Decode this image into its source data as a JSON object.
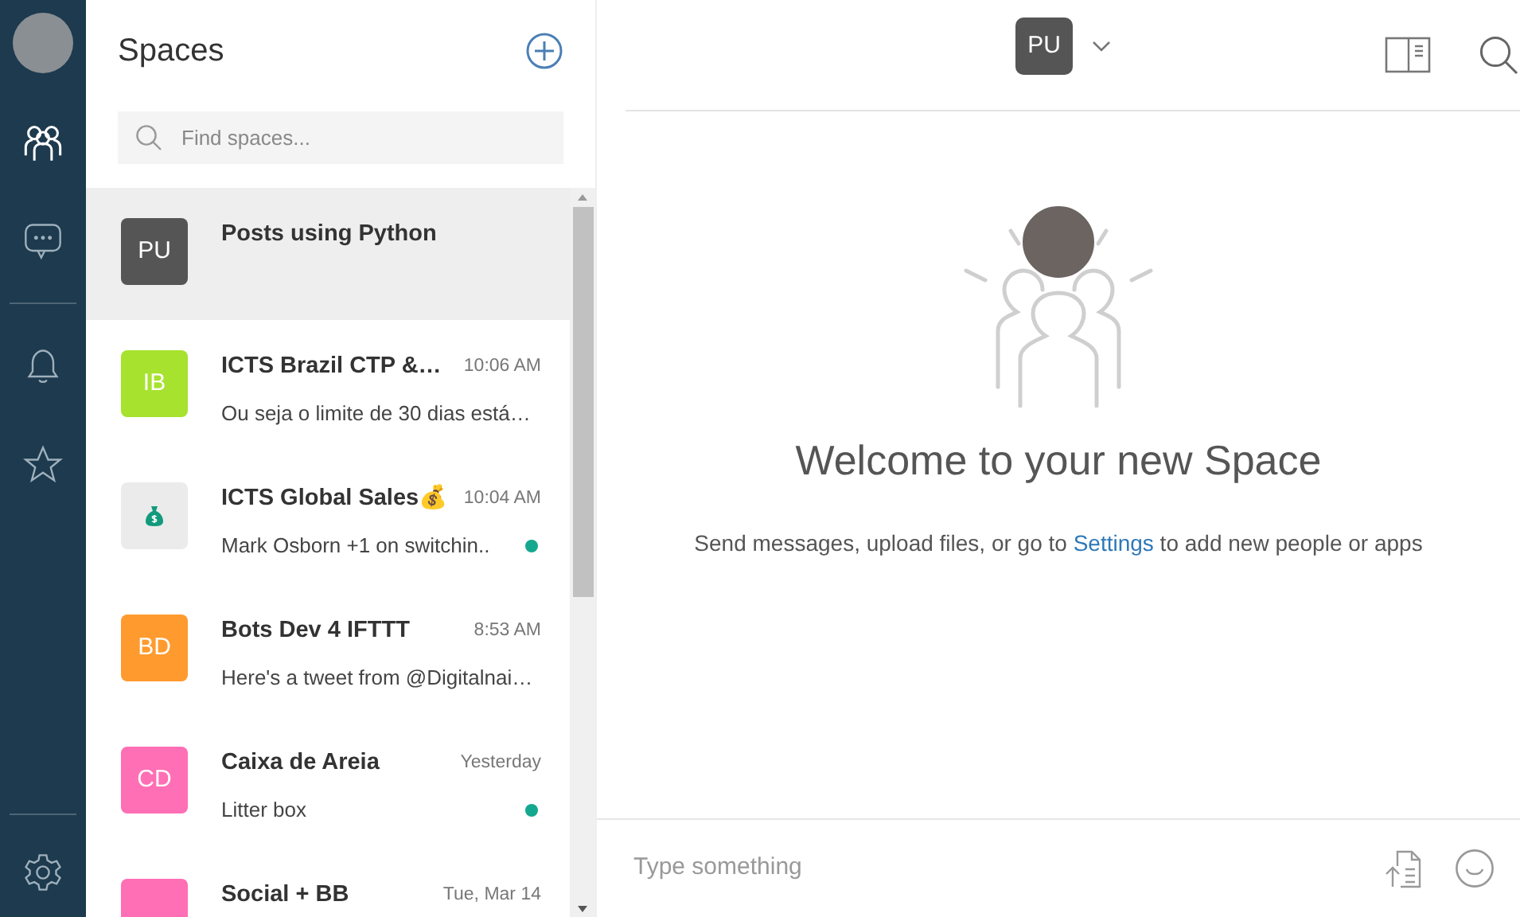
{
  "rail": {
    "items": [
      {
        "kind": "spaces",
        "selected": true
      },
      {
        "kind": "chat",
        "selected": false
      },
      {
        "kind": "bell",
        "selected": false
      },
      {
        "kind": "star",
        "selected": false
      }
    ]
  },
  "spaces": {
    "title": "Spaces",
    "search": {
      "placeholder": "Find spaces..."
    },
    "items": [
      {
        "initials": "PU",
        "color": "#555555",
        "name": "Posts using Python",
        "selected": true,
        "unread": false
      },
      {
        "initials": "IB",
        "color": "#a6e22e",
        "name": "ICTS Brazil CTP &…",
        "time": "10:06 AM",
        "preview": "Ou seja o limite de 30 dias está…",
        "selected": false,
        "unread": false
      },
      {
        "kind": "icon",
        "color": "#ebebeb",
        "name": "ICTS Global Sales💰",
        "time": "10:04 AM",
        "preview": "Mark Osborn +1 on switchin..",
        "selected": false,
        "unread": true
      },
      {
        "initials": "BD",
        "color": "#ff9a2e",
        "name": "Bots Dev 4 IFTTT",
        "time": "8:53 AM",
        "preview": "Here's a tweet from @Digitalnai…",
        "selected": false,
        "unread": false
      },
      {
        "initials": "CD",
        "color": "#ff6fb5",
        "name": "Caixa de Areia",
        "time": "Yesterday",
        "preview": "Litter box",
        "selected": false,
        "unread": true
      },
      {
        "color": "#ff6fb5",
        "name": "Social + BB",
        "time": "Tue, Mar 14",
        "selected": false,
        "unread": false
      }
    ]
  },
  "header": {
    "initials": "PU"
  },
  "welcome": {
    "title": "Welcome to your new Space",
    "text_before": "Send messages, upload files, or go to",
    "link": "Settings",
    "text_after": "to add new people or apps"
  },
  "composer": {
    "placeholder": "Type something"
  }
}
